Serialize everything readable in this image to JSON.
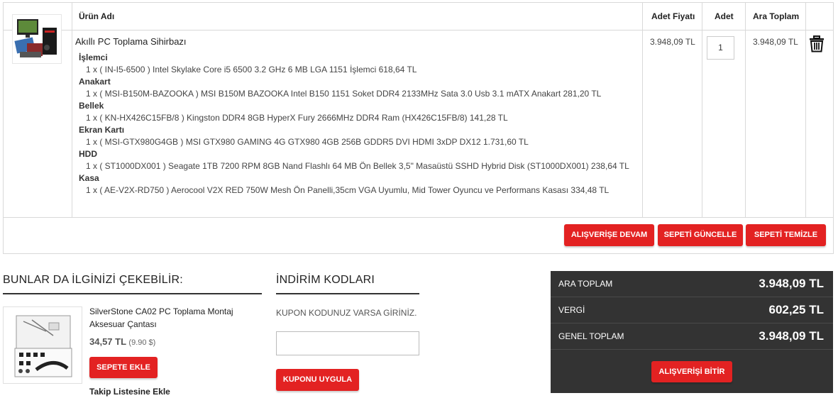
{
  "cart": {
    "headers": {
      "product": "Ürün Adı",
      "unit_price": "Adet Fiyatı",
      "qty": "Adet",
      "subtotal": "Ara Toplam"
    },
    "item": {
      "name": "Akıllı PC Toplama Sihirbazı",
      "unit_price": "3.948,09 TL",
      "qty": "1",
      "subtotal": "3.948,09 TL",
      "components": [
        {
          "category": "İşlemci",
          "line": "1 x ( IN-I5-6500 ) Intel Skylake Core i5 6500 3.2 GHz 6 MB LGA 1151 İşlemci 618,64 TL"
        },
        {
          "category": "Anakart",
          "line": "1 x ( MSI-B150M-BAZOOKA ) MSI B150M BAZOOKA Intel B150 1151 Soket DDR4 2133MHz Sata 3.0 Usb 3.1 mATX Anakart 281,20 TL"
        },
        {
          "category": "Bellek",
          "line": "1 x ( KN-HX426C15FB/8 ) Kingston DDR4 8GB HyperX Fury 2666MHz DDR4 Ram (HX426C15FB/8) 141,28 TL"
        },
        {
          "category": "Ekran Kartı",
          "line": "1 x ( MSI-GTX980G4GB ) MSI GTX980 GAMING 4G GTX980 4GB 256B GDDR5 DVI HDMI 3xDP DX12 1.731,60 TL"
        },
        {
          "category": "HDD",
          "line": "1 x ( ST1000DX001 ) Seagate 1TB 7200 RPM 8GB Nand Flashlı 64 MB Ön Bellek 3,5\" Masaüstü SSHD Hybrid Disk (ST1000DX001) 238,64 TL"
        },
        {
          "category": "Kasa",
          "line": "1 x ( AE-V2X-RD750 ) Aerocool V2X RED 750W Mesh Ön Panelli,35cm VGA Uyumlu, Mid Tower Oyuncu ve Performans Kasası 334,48 TL"
        }
      ]
    },
    "buttons": {
      "continue": "ALIŞVERİŞE DEVAM",
      "update": "SEPETİ GÜNCELLE",
      "clear": "SEPETİ TEMİZLE"
    }
  },
  "recommend": {
    "title": "BUNLAR DA İLGİNİZİ ÇEKEBİLİR:",
    "product": {
      "name": "SilverStone CA02 PC Toplama Montaj Aksesuar Çantası",
      "price": "34,57 TL",
      "usd": "(9.90 $)",
      "add_button": "SEPETE EKLE",
      "watch": "Takip Listesine Ekle"
    }
  },
  "coupon": {
    "title": "İNDİRİM KODLARI",
    "label": "KUPON KODUNUZ VARSA GİRİNİZ.",
    "value": "",
    "apply_button": "KUPONU UYGULA"
  },
  "totals": {
    "subtotal_label": "ARA TOPLAM",
    "subtotal": "3.948,09 TL",
    "tax_label": "VERGİ",
    "tax": "602,25 TL",
    "total_label": "GENEL TOPLAM",
    "total": "3.948,09 TL",
    "checkout_button": "ALIŞVERİŞİ BİTİR"
  },
  "colors": {
    "accent": "#e32222",
    "totals_bg": "#333333"
  },
  "icons": {
    "delete": "trash-icon"
  }
}
